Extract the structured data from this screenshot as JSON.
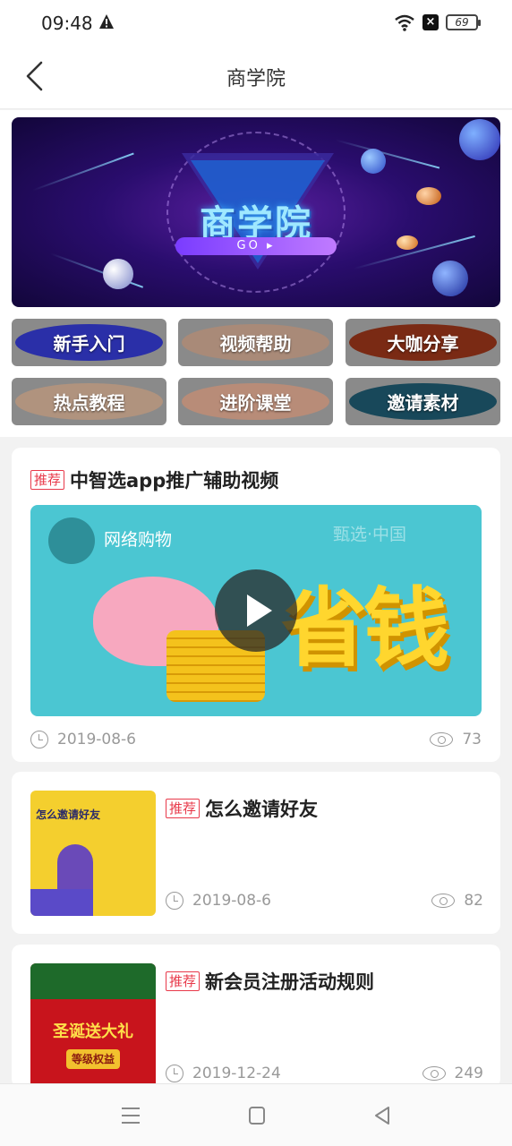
{
  "status": {
    "time": "09:48",
    "battery": "69"
  },
  "header": {
    "title": "商学院"
  },
  "banner": {
    "title": "商学院",
    "go": "GO ▸"
  },
  "categories": [
    {
      "label": "新手入门",
      "color": "#2a2fa8"
    },
    {
      "label": "视频帮助",
      "color": "#a98a78"
    },
    {
      "label": "大咖分享",
      "color": "#7a2a14"
    },
    {
      "label": "热点教程",
      "color": "#b0937e"
    },
    {
      "label": "进阶课堂",
      "color": "#b88c78"
    },
    {
      "label": "邀请素材",
      "color": "#18485a"
    }
  ],
  "articles": [
    {
      "tag": "推荐",
      "title": "中智选app推广辅助视频",
      "date": "2019-08-6",
      "views": "73",
      "video": {
        "channel": "网络购物",
        "watermark": "甄选·中国",
        "big_text": "省钱"
      }
    },
    {
      "tag": "推荐",
      "title": "怎么邀请好友",
      "date": "2019-08-6",
      "views": "82",
      "thumb_text": "怎么邀请好友"
    },
    {
      "tag": "推荐",
      "title": "新会员注册活动规则",
      "date": "2019-12-24",
      "views": "249",
      "thumb_text": "圣诞送大礼",
      "thumb_sub": "等级权益"
    }
  ]
}
